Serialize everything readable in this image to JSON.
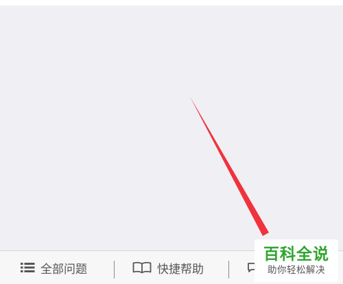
{
  "bottom_bar": {
    "items": [
      {
        "label": "全部问题",
        "icon": "list-icon"
      },
      {
        "label": "快捷帮助",
        "icon": "open-book-icon"
      },
      {
        "label": "",
        "icon": "partial-icon"
      }
    ]
  },
  "watermark": {
    "title": "百科全说",
    "subtitle": "助你轻松解决"
  },
  "annotation": {
    "color": "#f0323c"
  },
  "colors": {
    "content_bg": "#efeff4",
    "bar_bg": "#f7f7f7",
    "brand_green": "#2fa52f"
  }
}
